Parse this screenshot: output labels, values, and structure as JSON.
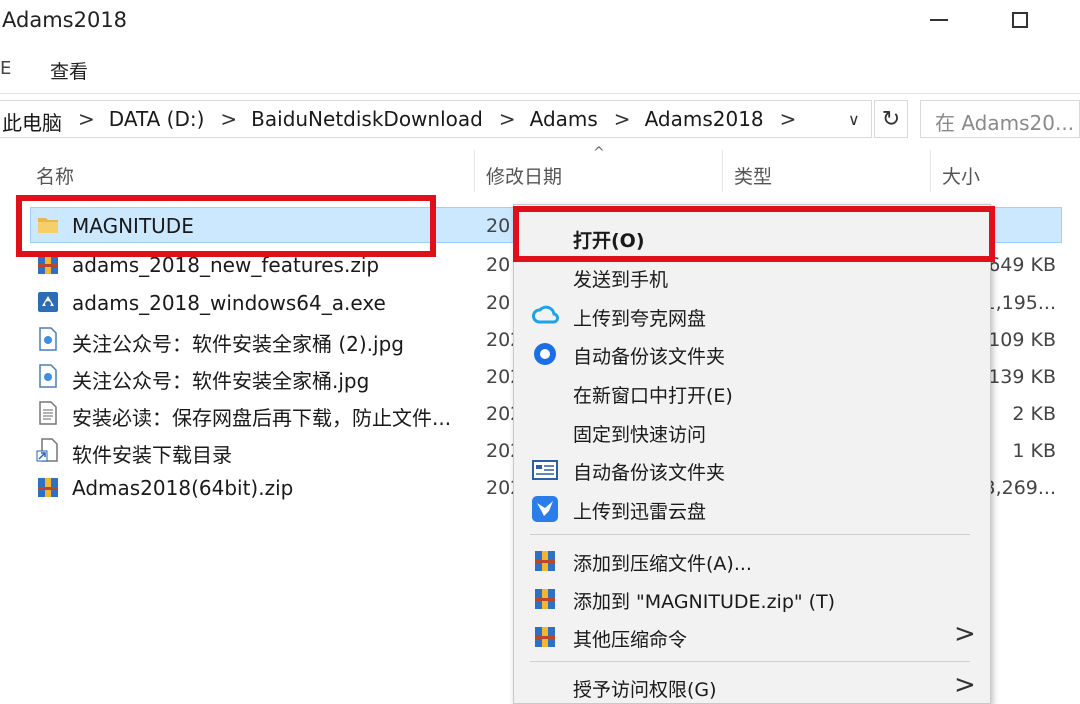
{
  "window": {
    "title": "Adams2018"
  },
  "ribbon": {
    "fold_label": "E",
    "view_tab": "查看"
  },
  "address_bar": {
    "crumbs": [
      "此电脑",
      "DATA (D:)",
      "BaiduNetdiskDownload",
      "Adams",
      "Adams2018"
    ],
    "separator": ">",
    "dropdown": "∨",
    "refresh": "↻",
    "search_placeholder": "在 Adams20..."
  },
  "columns": {
    "name": "名称",
    "date": "修改日期",
    "type": "类型",
    "size": "大小",
    "sort_indicator": "^"
  },
  "files": [
    {
      "name": "MAGNITUDE",
      "date": "20",
      "size": "",
      "icon": "folder-icon"
    },
    {
      "name": "adams_2018_new_features.zip",
      "date": "20",
      "size": "649 KB",
      "icon": "zip-archive-icon"
    },
    {
      "name": "adams_2018_windows64_a.exe",
      "date": "20",
      "size": "1,195...",
      "icon": "installer-exe-icon"
    },
    {
      "name": "关注公众号：软件安装全家桶 (2).jpg",
      "date": "202",
      "size": "109 KB",
      "icon": "image-file-icon"
    },
    {
      "name": "关注公众号：软件安装全家桶.jpg",
      "date": "202",
      "size": "139 KB",
      "icon": "image-file-icon"
    },
    {
      "name": "安装必读：保存网盘后再下载，防止文件...",
      "date": "202",
      "size": "2 KB",
      "icon": "text-file-icon"
    },
    {
      "name": "软件安装下载目录",
      "date": "202",
      "size": "1 KB",
      "icon": "shortcut-icon"
    },
    {
      "name": "Admas2018(64bit).zip",
      "date": "202",
      "size": "3,269...",
      "icon": "zip-archive-icon"
    }
  ],
  "context_menu": {
    "items": [
      {
        "label": "打开(O)",
        "icon": ""
      },
      {
        "label": "发送到手机",
        "icon": ""
      },
      {
        "label": "上传到夸克网盘",
        "icon": "quark-cloud-icon"
      },
      {
        "label": "自动备份该文件夹",
        "icon": "backup-circle-icon"
      },
      {
        "label": "在新窗口中打开(E)",
        "icon": ""
      },
      {
        "label": "固定到快速访问",
        "icon": ""
      },
      {
        "label": "自动备份该文件夹",
        "icon": "backup-window-icon"
      },
      {
        "label": "上传到迅雷云盘",
        "icon": "thunder-bird-icon"
      },
      {
        "label": "添加到压缩文件(A)...",
        "icon": "winrar-icon"
      },
      {
        "label": "添加到 \"MAGNITUDE.zip\" (T)",
        "icon": "winrar-icon"
      },
      {
        "label": "其他压缩命令",
        "icon": "winrar-icon"
      },
      {
        "label": "授予访问权限(G)",
        "icon": ""
      }
    ],
    "submenu_arrow": ">"
  },
  "colors": {
    "selection": "#cce8ff",
    "highlight": "#e0101a",
    "menu_bg": "#f2f2f2"
  }
}
